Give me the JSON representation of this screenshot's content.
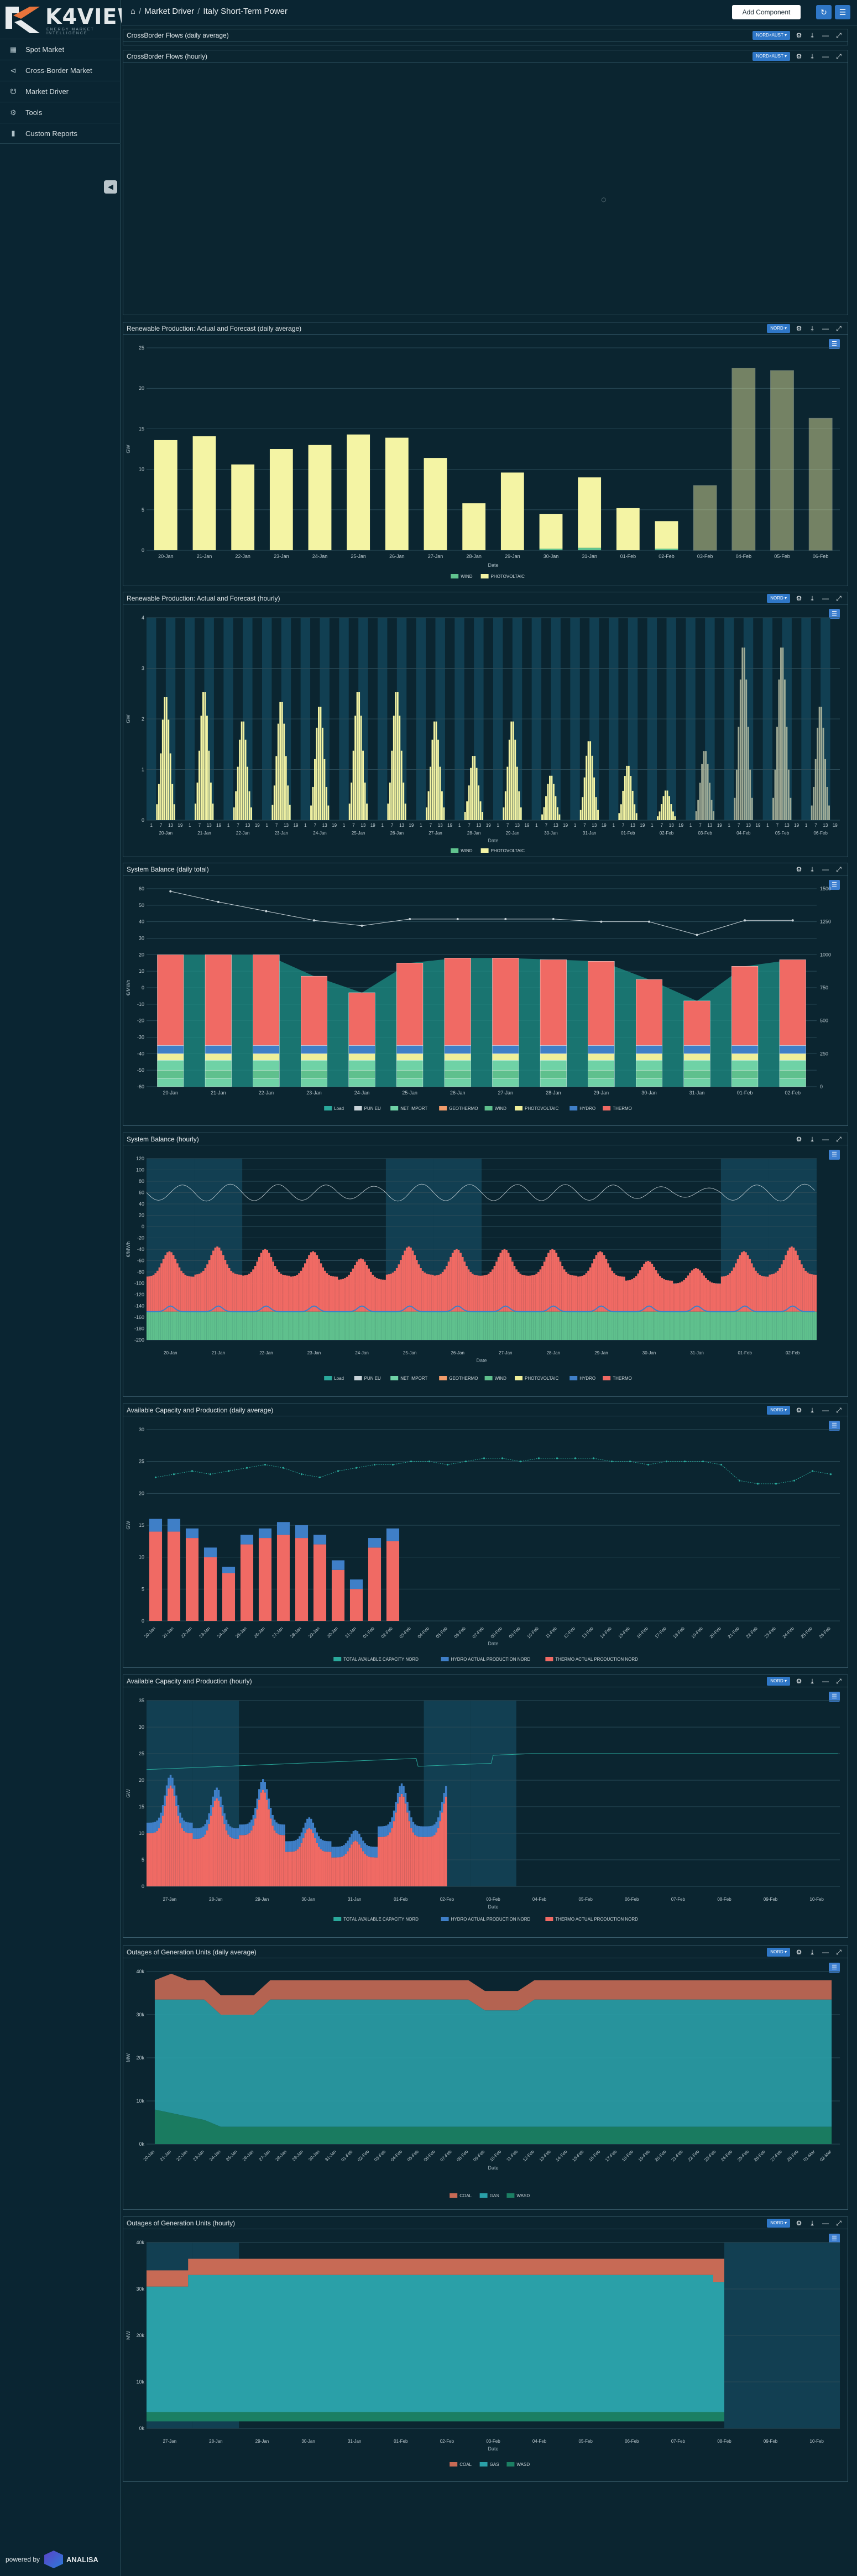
{
  "app": {
    "brand": "K4VIEW",
    "brand_tagline": "ENERGY MARKET INTELLIGENCE",
    "powered_by_label": "powered by",
    "powered_by_brand": "ANALISA"
  },
  "colors": {
    "bg": "#0b2530",
    "accent": "#2f77c7"
  },
  "nav": [
    {
      "label": "Spot Market",
      "icon": "grid-icon"
    },
    {
      "label": "Cross-Border Market",
      "icon": "share-icon"
    },
    {
      "label": "Market Driver",
      "icon": "tower-icon"
    },
    {
      "label": "Tools",
      "icon": "gear-icon"
    },
    {
      "label": "Custom Reports",
      "icon": "bar-chart-icon"
    }
  ],
  "topbar": {
    "crumb_1": "Market Driver",
    "crumb_2": "Italy Short-Term Power",
    "add_button": "Add Component"
  },
  "panels": [
    {
      "title": "CrossBorder Flows (daily average)",
      "selector": "NORD>AUST"
    },
    {
      "title": "CrossBorder Flows (hourly)",
      "selector": "NORD>AUST"
    },
    {
      "title": "Renewable Production: Actual and Forecast (daily average)",
      "selector": "NORD"
    },
    {
      "title": "Renewable Production: Actual and Forecast (hourly)",
      "selector": "NORD"
    },
    {
      "title": "System Balance (daily total)",
      "selector": ""
    },
    {
      "title": "System Balance (hourly)",
      "selector": ""
    },
    {
      "title": "Available Capacity and Production (daily average)",
      "selector": "NORD"
    },
    {
      "title": "Available Capacity and Production (hourly)",
      "selector": "NORD"
    },
    {
      "title": "Outages of Generation Units (daily average)",
      "selector": "NORD"
    },
    {
      "title": "Outages of Generation Units (hourly)",
      "selector": "NORD"
    }
  ],
  "chart_data": [
    {
      "type": "bar",
      "title": "Renewable Production: Actual and Forecast (daily average)",
      "xlabel": "Date",
      "ylabel": "GW",
      "ylim": [
        0,
        25
      ],
      "yticks": [
        0,
        5,
        10,
        15,
        20,
        25
      ],
      "categories": [
        "20-Jan",
        "21-Jan",
        "22-Jan",
        "23-Jan",
        "24-Jan",
        "25-Jan",
        "26-Jan",
        "27-Jan",
        "28-Jan",
        "29-Jan",
        "30-Jan",
        "31-Jan",
        "01-Feb",
        "02-Feb",
        "03-Feb",
        "04-Feb",
        "05-Feb",
        "06-Feb"
      ],
      "series": [
        {
          "name": "WIND",
          "color": "#61c48f",
          "values": [
            0,
            0,
            0,
            0,
            0,
            0,
            0,
            0,
            0,
            0,
            0.2,
            0.3,
            0,
            0.2,
            0,
            0,
            0,
            0
          ]
        },
        {
          "name": "PHOTOVOLTAIC",
          "color": "#f4f4a4",
          "values": [
            13.6,
            14.1,
            10.6,
            12.5,
            13,
            14.3,
            13.9,
            11.4,
            5.8,
            9.6,
            4.3,
            8.7,
            5.2,
            3.4,
            8,
            22.5,
            22.2,
            16.3
          ]
        }
      ],
      "forecast_from_index": 14,
      "legend": "bottom"
    },
    {
      "type": "area",
      "title": "Renewable Production: Actual and Forecast (hourly)",
      "xlabel": "Date",
      "ylabel": "GW",
      "ylim": [
        0,
        4
      ],
      "yticks": [
        0,
        1,
        2,
        3,
        4
      ],
      "days": [
        "20-Jan",
        "21-Jan",
        "22-Jan",
        "23-Jan",
        "24-Jan",
        "25-Jan",
        "26-Jan",
        "27-Jan",
        "28-Jan",
        "29-Jan",
        "30-Jan",
        "31-Jan",
        "01-Feb",
        "02-Feb",
        "03-Feb",
        "04-Feb",
        "05-Feb",
        "06-Feb"
      ],
      "hour_ticks": [
        "1",
        "7",
        "13",
        "19"
      ],
      "daily_peak": [
        2.5,
        2.6,
        2.0,
        2.4,
        2.3,
        2.6,
        2.6,
        2.0,
        1.3,
        2.0,
        0.9,
        1.6,
        1.1,
        0.6,
        1.4,
        3.5,
        3.5,
        2.3
      ],
      "series": [
        {
          "name": "WIND",
          "color": "#61c48f"
        },
        {
          "name": "PHOTOVOLTAIC",
          "color": "#f4f4a4"
        }
      ],
      "forecast_from_index": 14,
      "legend": "bottom"
    },
    {
      "type": "bar",
      "title": "System Balance (daily total)",
      "xlabel": "",
      "ylabel": "€/MWh",
      "ylim": [
        -60,
        60
      ],
      "y2lim": [
        0,
        1500
      ],
      "categories": [
        "20-Jan",
        "21-Jan",
        "22-Jan",
        "23-Jan",
        "24-Jan",
        "25-Jan",
        "26-Jan",
        "27-Jan",
        "28-Jan",
        "29-Jan",
        "30-Jan",
        "31-Jan",
        "01-Feb",
        "02-Feb"
      ],
      "load": [
        20,
        20,
        20,
        7,
        -3,
        15,
        18,
        18,
        17,
        16,
        5,
        -8,
        13,
        17
      ],
      "series": [
        {
          "name": "Load",
          "color": "#2aa99b"
        },
        {
          "name": "PUN EU",
          "color": "#c9d4d9",
          "values": [
            1480,
            1400,
            1330,
            1260,
            1220,
            1270,
            1270,
            1270,
            1270,
            1250,
            1250,
            1150,
            1260,
            1260
          ]
        },
        {
          "name": "NET IMPORT",
          "color": "#6fd2a6"
        },
        {
          "name": "GEOTHERMO",
          "color": "#f29c6b"
        },
        {
          "name": "WIND",
          "color": "#5fc08d"
        },
        {
          "name": "PHOTOVOLTAIC",
          "color": "#efef9a"
        },
        {
          "name": "HYDRO",
          "color": "#3f7fc7"
        },
        {
          "name": "THERMO",
          "color": "#f06a64"
        }
      ],
      "legend": "bottom"
    },
    {
      "type": "area",
      "title": "System Balance (hourly)",
      "xlabel": "Date",
      "ylabel": "€/MWh",
      "ylim": [
        -200,
        120
      ],
      "yticks": [
        120,
        100,
        80,
        60,
        40,
        20,
        0,
        -20,
        -40,
        -60,
        -80,
        -100,
        -120,
        -140,
        -160,
        -180,
        -200
      ],
      "days": [
        "20-Jan",
        "21-Jan",
        "22-Jan",
        "23-Jan",
        "24-Jan",
        "25-Jan",
        "26-Jan",
        "27-Jan",
        "28-Jan",
        "29-Jan",
        "30-Jan",
        "31-Jan",
        "01-Feb",
        "02-Feb"
      ],
      "series": [
        {
          "name": "Load",
          "color": "#2aa99b"
        },
        {
          "name": "PUN EU",
          "color": "#c9d4d9"
        },
        {
          "name": "NET IMPORT",
          "color": "#6fd2a6"
        },
        {
          "name": "GEOTHERMO",
          "color": "#f29c6b"
        },
        {
          "name": "WIND",
          "color": "#5fc08d"
        },
        {
          "name": "PHOTOVOLTAIC",
          "color": "#efef9a"
        },
        {
          "name": "HYDRO",
          "color": "#3f7fc7"
        },
        {
          "name": "THERMO",
          "color": "#f06a64"
        }
      ],
      "legend": "bottom"
    },
    {
      "type": "bar",
      "title": "Available Capacity and Production (daily average)",
      "xlabel": "Date",
      "ylabel": "GW",
      "ylim": [
        0,
        30
      ],
      "yticks": [
        0,
        5,
        10,
        15,
        20,
        25,
        30
      ],
      "categories": [
        "20-Jan",
        "21-Jan",
        "22-Jan",
        "23-Jan",
        "24-Jan",
        "25-Jan",
        "26-Jan",
        "27-Jan",
        "28-Jan",
        "29-Jan",
        "30-Jan",
        "31-Jan",
        "01-Feb",
        "02-Feb",
        "03-Feb",
        "04-Feb",
        "05-Feb",
        "06-Feb",
        "07-Feb",
        "08-Feb",
        "09-Feb",
        "10-Feb",
        "11-Feb",
        "12-Feb",
        "13-Feb",
        "14-Feb",
        "15-Feb",
        "16-Feb",
        "17-Feb",
        "18-Feb",
        "19-Feb",
        "20-Feb",
        "21-Feb",
        "22-Feb",
        "23-Feb",
        "24-Feb",
        "25-Feb",
        "26-Feb"
      ],
      "series": [
        {
          "name": "TOTAL AVAILABLE CAPACITY NORD",
          "color": "#2aa99b",
          "values": [
            22.5,
            23,
            23.5,
            23,
            23.5,
            24,
            24.5,
            24,
            23,
            22.5,
            23.5,
            24,
            24.5,
            24.5,
            25,
            25,
            24.5,
            25,
            25.5,
            25.5,
            25,
            25.5,
            25.5,
            25.5,
            25.5,
            25,
            25,
            24.5,
            25,
            25,
            25,
            24.5,
            22,
            21.5,
            21.5,
            22,
            23.5,
            23
          ]
        },
        {
          "name": "HYDRO ACTUAL PRODUCTION NORD",
          "color": "#3f7fc7",
          "values": [
            2,
            2,
            1.5,
            1.5,
            1,
            1.5,
            1.5,
            2,
            2,
            1.5,
            1.5,
            1.5,
            1.5,
            2
          ]
        },
        {
          "name": "THERMO ACTUAL PRODUCTION NORD",
          "color": "#f06a64",
          "values": [
            14,
            14,
            13,
            10,
            7.5,
            12,
            13,
            13.5,
            13,
            12,
            8,
            5,
            11.5,
            12.5
          ]
        }
      ],
      "legend": "bottom"
    },
    {
      "type": "area",
      "title": "Available Capacity and Production (hourly)",
      "xlabel": "Date",
      "ylabel": "GW",
      "ylim": [
        0,
        35
      ],
      "yticks": [
        0,
        5,
        10,
        15,
        20,
        25,
        30,
        35
      ],
      "days": [
        "27-Jan",
        "28-Jan",
        "29-Jan",
        "30-Jan",
        "31-Jan",
        "01-Feb",
        "02-Feb",
        "03-Feb",
        "04-Feb",
        "05-Feb",
        "06-Feb",
        "07-Feb",
        "08-Feb",
        "09-Feb",
        "10-Feb"
      ],
      "series": [
        {
          "name": "TOTAL AVAILABLE CAPACITY NORD",
          "color": "#2aa99b"
        },
        {
          "name": "HYDRO ACTUAL PRODUCTION NORD",
          "color": "#3f7fc7"
        },
        {
          "name": "THERMO ACTUAL PRODUCTION NORD",
          "color": "#f06a64"
        }
      ],
      "legend": "bottom"
    },
    {
      "type": "area",
      "title": "Outages of Generation Units (daily average)",
      "xlabel": "Date",
      "ylabel": "MW",
      "ylim": [
        0,
        40000
      ],
      "yticks_labels": [
        "0k",
        "10k",
        "20k",
        "30k",
        "40k"
      ],
      "categories": [
        "20-Jan",
        "21-Jan",
        "22-Jan",
        "23-Jan",
        "24-Jan",
        "25-Jan",
        "26-Jan",
        "27-Jan",
        "28-Jan",
        "29-Jan",
        "30-Jan",
        "31-Jan",
        "01-Feb",
        "02-Feb",
        "03-Feb",
        "04-Feb",
        "05-Feb",
        "06-Feb",
        "07-Feb",
        "08-Feb",
        "09-Feb",
        "10-Feb",
        "11-Feb",
        "12-Feb",
        "13-Feb",
        "14-Feb",
        "15-Feb",
        "16-Feb",
        "17-Feb",
        "18-Feb",
        "19-Feb",
        "20-Feb",
        "21-Feb",
        "22-Feb",
        "23-Feb",
        "24-Feb",
        "25-Feb",
        "26-Feb",
        "27-Feb",
        "28-Feb",
        "01-Mar",
        "02-Mar"
      ],
      "series": [
        {
          "name": "COAL",
          "color": "#c76a55"
        },
        {
          "name": "GAS",
          "color": "#2aa0a8"
        },
        {
          "name": "WASD",
          "color": "#1b7f63"
        }
      ],
      "legend": "bottom"
    },
    {
      "type": "area",
      "title": "Outages of Generation Units (hourly)",
      "xlabel": "Date",
      "ylabel": "MW",
      "ylim": [
        0,
        40000
      ],
      "yticks_labels": [
        "0k",
        "10k",
        "20k",
        "30k",
        "40k"
      ],
      "days": [
        "27-Jan",
        "28-Jan",
        "29-Jan",
        "30-Jan",
        "31-Jan",
        "01-Feb",
        "02-Feb",
        "03-Feb",
        "04-Feb",
        "05-Feb",
        "06-Feb",
        "07-Feb",
        "08-Feb",
        "09-Feb",
        "10-Feb"
      ],
      "series": [
        {
          "name": "COAL",
          "color": "#c76a55"
        },
        {
          "name": "GAS",
          "color": "#2aa0a8"
        },
        {
          "name": "WASD",
          "color": "#1b7f63"
        }
      ],
      "legend": "bottom"
    }
  ]
}
